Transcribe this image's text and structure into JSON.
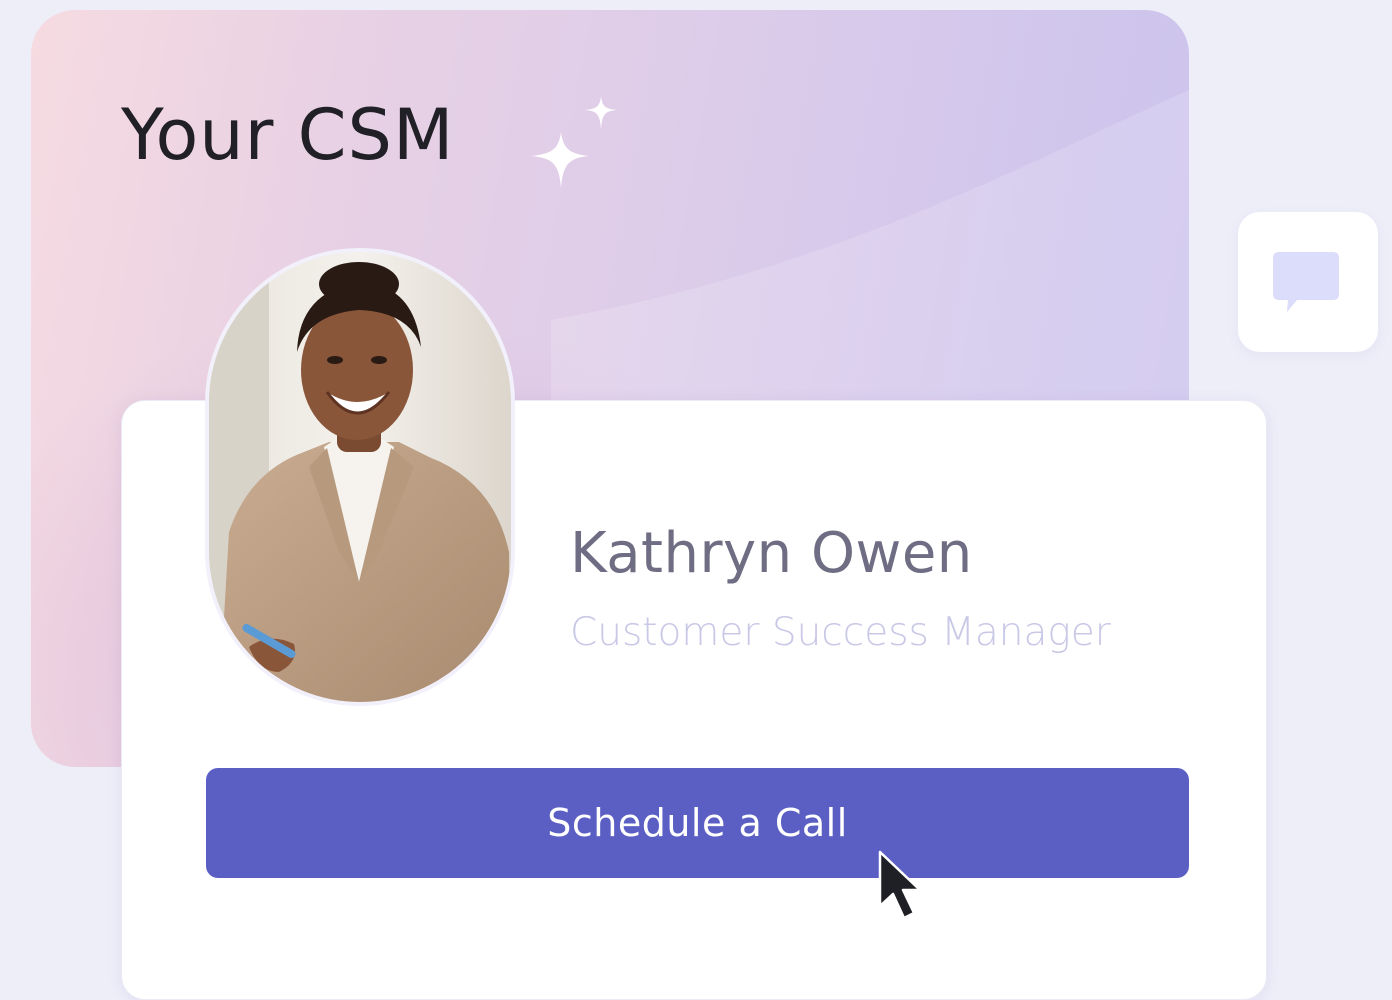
{
  "hero": {
    "title": "Your CSM"
  },
  "profile": {
    "name": "Kathryn Owen",
    "role": "Customer Success Manager",
    "photo_alt": "Smiling woman in a beige blazer"
  },
  "actions": {
    "schedule_label": "Schedule a Call"
  },
  "icons": {
    "sparkle": "sparkle-icon",
    "chat": "chat-bubble-icon",
    "cursor": "mouse-pointer-icon"
  },
  "colors": {
    "accent": "#5b5fc4",
    "page_bg": "#eeeef9",
    "chat_icon": "#dcdcfb",
    "name_text": "#6e6d83",
    "role_text": "#c9c8e6"
  }
}
